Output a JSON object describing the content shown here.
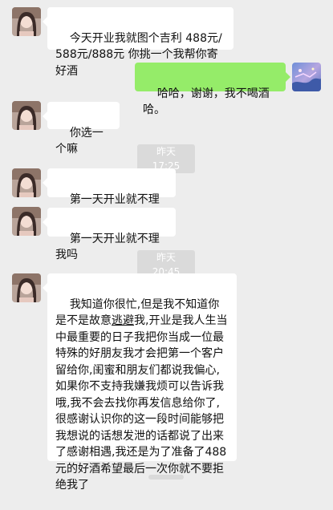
{
  "conversation": {
    "messages": [
      {
        "sender": "contact",
        "text": "今天开业我就图个吉利 488元/588元/888元 你挑一个我帮你寄好酒"
      },
      {
        "sender": "me",
        "text": "哈哈，谢谢，我不喝酒哈。"
      },
      {
        "sender": "contact",
        "text": "你选一个嘛"
      },
      {
        "type": "time",
        "text": "昨天 17:25"
      },
      {
        "sender": "contact",
        "text": "第一天开业就不理我吗"
      },
      {
        "sender": "contact",
        "text": "第一天开业就不理我吗"
      },
      {
        "type": "time",
        "text": "昨天 20:45"
      },
      {
        "sender": "contact",
        "text_before": "我知道你很忙,但是我不知道你是不是故意",
        "text_underlined": "逃避",
        "text_after": "我,开业是我人生当中最重要的日子我把你当成一位最特殊的好朋友我才会把第一个客户留给你,闺蜜和朋友们都说我偏心,如果你不支持我嫌我烦可以告诉我哦,我不会去找你再发信息给你了,很感谢认识你的这一段时间能够把我想说的话想发泄的话都说了出来了感谢相遇,我还是为了准备了488元的好酒希望最后一次你就不要拒绝我了"
      }
    ]
  },
  "colors": {
    "background": "#ededed",
    "contact_bubble": "#ffffff",
    "my_bubble": "#95ec69",
    "timestamp_bg": "#dadada",
    "timestamp_text": "#ffffff"
  },
  "icons": {
    "contact_avatar": "contact-avatar-photo",
    "my_avatar": "my-avatar-photo"
  }
}
